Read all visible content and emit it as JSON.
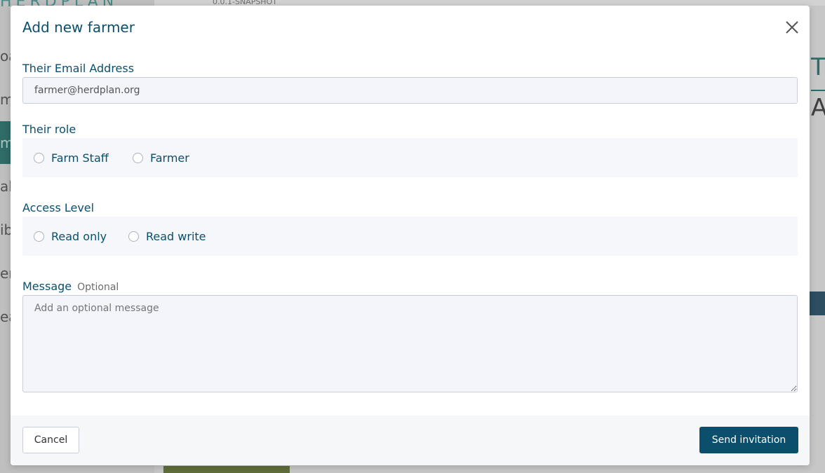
{
  "background": {
    "brand": "HERDPLAN",
    "version": "0.0.1-SNAPSHOT",
    "nav_fragments": [
      "oa",
      "m",
      "m",
      "alt",
      "ib",
      "er",
      "ea"
    ],
    "header_fragments": [
      "T",
      "A"
    ]
  },
  "modal": {
    "title": "Add new farmer",
    "close_icon": "close-icon",
    "email": {
      "label": "Their Email Address",
      "value": "farmer@herdplan.org"
    },
    "role": {
      "label": "Their role",
      "options": [
        "Farm Staff",
        "Farmer"
      ]
    },
    "access": {
      "label": "Access Level",
      "options": [
        "Read only",
        "Read write"
      ]
    },
    "message": {
      "label": "Message",
      "optional": "Optional",
      "placeholder": "Add an optional message"
    },
    "footer": {
      "cancel_label": "Cancel",
      "send_label": "Send invitation"
    }
  },
  "colors": {
    "primary": "#0b4f6c",
    "overlay": "#7a7a7a",
    "input_bg": "#f3f5fb"
  }
}
